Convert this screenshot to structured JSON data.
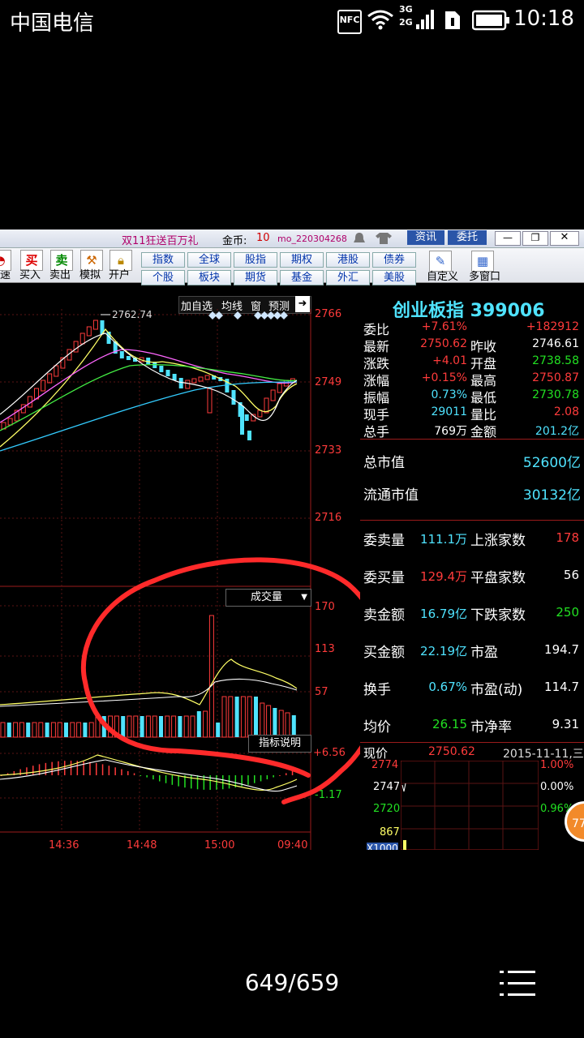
{
  "status_bar": {
    "carrier": "中国电信",
    "clock": "10:18",
    "nfc": "NFC",
    "net_3g": "3G",
    "net_2g": "2G"
  },
  "window": {
    "promo": "双11狂送百万礼",
    "coins_label": "金币:",
    "coins_value": "10",
    "user": "mo_220304268",
    "btn_news": "资讯",
    "btn_entrust": "委托"
  },
  "toolbar": {
    "buy": "买入",
    "sell": "卖出",
    "simulate": "模拟",
    "open_account": "开户",
    "speed": "速",
    "buy_glyph": "买",
    "sell_glyph": "卖",
    "nav_row1": [
      "指数",
      "全球",
      "股指",
      "期权",
      "港股",
      "债券"
    ],
    "nav_row2": [
      "个股",
      "板块",
      "期货",
      "基金",
      "外汇",
      "美股"
    ],
    "custom": "自定义",
    "multi_window": "多窗口"
  },
  "chart_menu": {
    "add_watch": "加自选",
    "avg_line": "均线",
    "window": "窗",
    "forecast": "预测"
  },
  "stock": {
    "name": "创业板指 399006"
  },
  "price_axis": [
    "2766",
    "2749",
    "2733",
    "2716"
  ],
  "volume_axis": [
    "170",
    "113",
    "57"
  ],
  "macd_axis": [
    "+6.56",
    "-1.17"
  ],
  "time_axis": [
    "14:36",
    "14:48",
    "15:00",
    "09:40"
  ],
  "peak_label": "2762.74",
  "volume_dropdown": "成交量",
  "indicator_help": "指标说明",
  "quote": {
    "rows": [
      {
        "l": "委比",
        "v": "+7.61%",
        "l2": "",
        "v2": "+182912"
      },
      {
        "l": "最新",
        "v": "2750.62",
        "l2": "昨收",
        "v2": "2746.61"
      },
      {
        "l": "涨跌",
        "v": "+4.01",
        "l2": "开盘",
        "v2": "2738.58"
      },
      {
        "l": "涨幅",
        "v": "+0.15%",
        "l2": "最高",
        "v2": "2750.87"
      },
      {
        "l": "振幅",
        "v": "0.73%",
        "l2": "最低",
        "v2": "2730.78"
      },
      {
        "l": "现手",
        "v": "29011",
        "l2": "量比",
        "v2": "2.08"
      },
      {
        "l": "总手",
        "v": "769万",
        "l2": "金额",
        "v2": "201.2亿"
      }
    ],
    "total_mv_label": "总市值",
    "total_mv": "52600亿",
    "float_mv_label": "流通市值",
    "float_mv": "30132亿",
    "stats": [
      {
        "l": "委卖量",
        "v": "111.1万",
        "l2": "上涨家数",
        "v2": "178"
      },
      {
        "l": "委买量",
        "v": "129.4万",
        "l2": "平盘家数",
        "v2": "56"
      },
      {
        "l": "卖金额",
        "v": "16.79亿",
        "l2": "下跌家数",
        "v2": "250"
      },
      {
        "l": "买金额",
        "v": "22.19亿",
        "l2": "市盈",
        "v2": "194.7"
      },
      {
        "l": "换手",
        "v": "0.67%",
        "l2": "市盈(动)",
        "v2": "114.7"
      },
      {
        "l": "均价",
        "v": "26.15",
        "l2": "市净率",
        "v2": "9.31"
      }
    ],
    "current_label": "现价",
    "current_value": "2750.62",
    "date": "2015-11-11,三",
    "mini_axis": [
      "2774",
      "2747",
      "2720",
      "867",
      "X1000"
    ],
    "mini_pct": [
      "1.00%",
      "0.00%",
      "0.96%"
    ]
  },
  "badge": "77",
  "pager": "649/659",
  "colors": {
    "up": "#ff3b3b",
    "down": "#4fe3ff",
    "bg": "#000000",
    "annotation": "#ff2a2a"
  }
}
